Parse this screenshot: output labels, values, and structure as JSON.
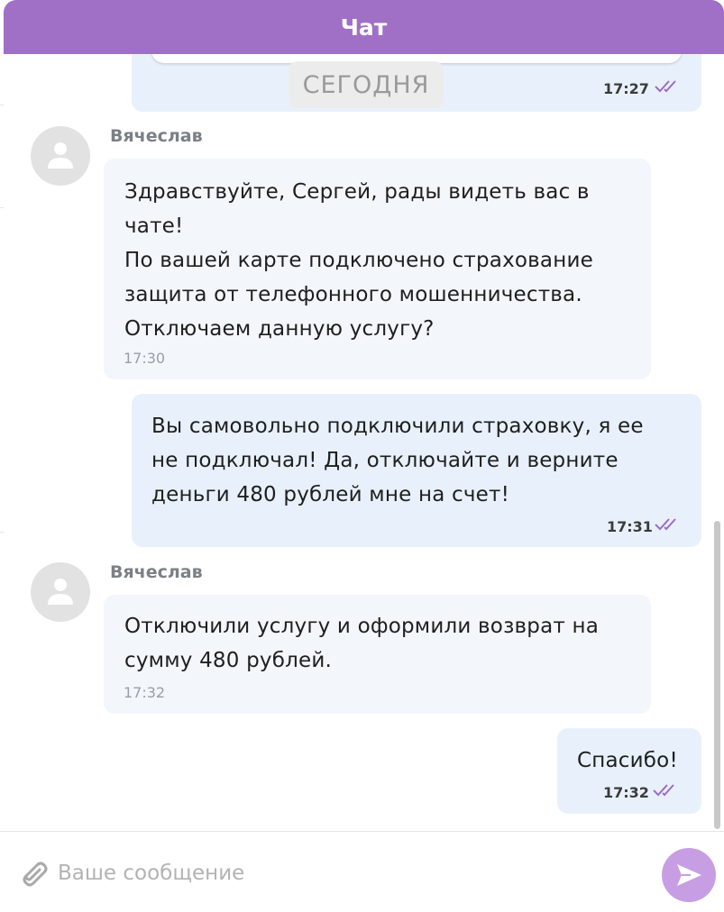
{
  "header": {
    "title": "Чат"
  },
  "date_divider": "СЕГОДНЯ",
  "previous_message": {
    "time": "17:27"
  },
  "messages": [
    {
      "sender": "Вячеслав",
      "text": "Здравствуйте, Сергей, рады видеть вас в\nчате!\nПо вашей карте подключено страхование\nзащита от телефонного мошенничества.\nОтключаем данную услугу?",
      "time": "17:30"
    },
    {
      "text": "Вы самовольно подключили страховку, я ее\nне подключал! Да, отключайте и верните\nденьги 480 рублей мне на счет!",
      "time": "17:31"
    },
    {
      "sender": "Вячеслав",
      "text": "Отключили услугу и оформили возврат на\nсумму 480 рублей.",
      "time": "17:32"
    },
    {
      "text": "Спасибо!",
      "time": "17:32"
    }
  ],
  "composer": {
    "placeholder": "Ваше сообщение"
  },
  "colors": {
    "header": "#a070c6",
    "outgoing_bubble": "#e8f1fb",
    "incoming_bubble": "#f3f6fb",
    "read_ticks": "#9b6cc8",
    "send_button": "#c79ee4"
  },
  "icons": {
    "avatar": "user-icon",
    "read_status": "double-check-icon",
    "attach": "paperclip-icon",
    "send": "send-icon"
  }
}
